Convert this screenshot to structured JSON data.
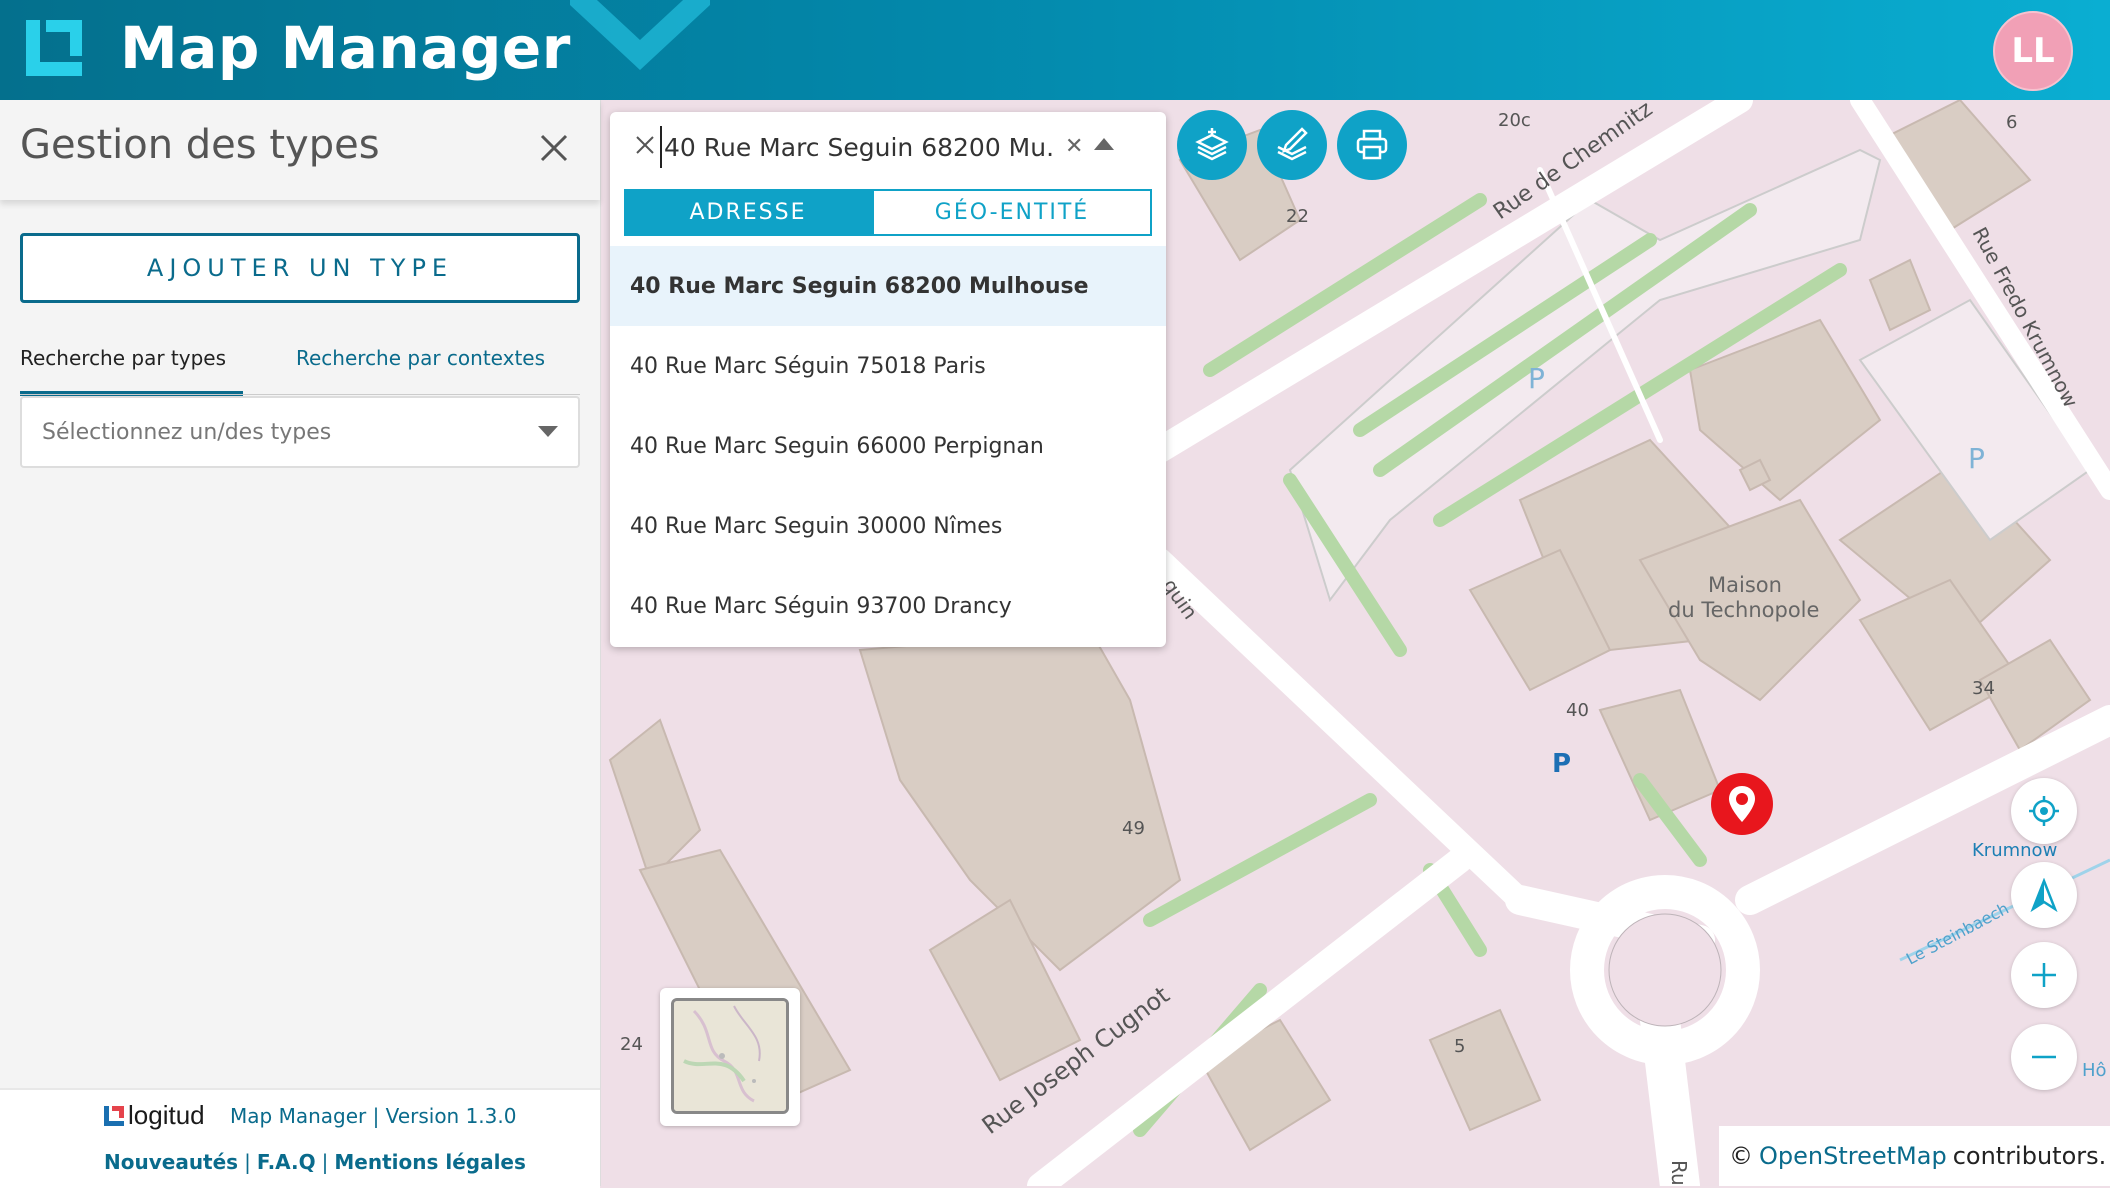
{
  "app": {
    "title": "Map Manager",
    "user_initials": "LL"
  },
  "sidebar": {
    "title": "Gestion des types",
    "add_button": "AJOUTER UN TYPE",
    "tabs": [
      {
        "label": "Recherche par types",
        "active": true
      },
      {
        "label": "Recherche par contextes",
        "active": false
      }
    ],
    "select_placeholder": "Sélectionnez un/des types",
    "footer": {
      "brand": "logitud",
      "version": "Map Manager | Version 1.3.0",
      "links": [
        "Nouveautés",
        "F.A.Q",
        "Mentions légales"
      ]
    }
  },
  "search": {
    "value": "40 Rue Marc Seguin 68200 Mu...",
    "modes": [
      {
        "label": "ADRESSE",
        "active": true
      },
      {
        "label": "GÉO-ENTITÉ",
        "active": false
      }
    ],
    "results": [
      "40 Rue Marc Seguin 68200 Mulhouse",
      "40 Rue Marc Séguin 75018 Paris",
      "40 Rue Marc Seguin 66000 Perpignan",
      "40 Rue Marc Seguin 30000 Nîmes",
      "40 Rue Marc Séguin 93700 Drancy"
    ]
  },
  "map": {
    "labels": {
      "rue_chemnitz": "Rue de Chemnitz",
      "rue_fredo": "Rue Fredo Krumnow",
      "rue_cugnot": "Rue Joseph Cugnot",
      "maison": "Maison",
      "technopole": "du Technopole",
      "krumnow": "Krumnow",
      "steinbaech": "Le Steinbaech",
      "quin": "quin",
      "ru": "Ru",
      "n20c": "20c",
      "n22": "22",
      "n6": "6",
      "n40": "40",
      "n49": "49",
      "n34": "34",
      "n24": "24",
      "n5": "5",
      "ho": "Hô"
    },
    "attribution_prefix": "©",
    "attribution_link": "OpenStreetMap",
    "attribution_suffix": "contributors."
  },
  "colors": {
    "brand": "#0a6b8c",
    "accent": "#0fa2c7",
    "map_bg": "#efdfe7",
    "building": "#d9cdc4",
    "park": "#b5d8a6",
    "pin": "#e8161d"
  }
}
